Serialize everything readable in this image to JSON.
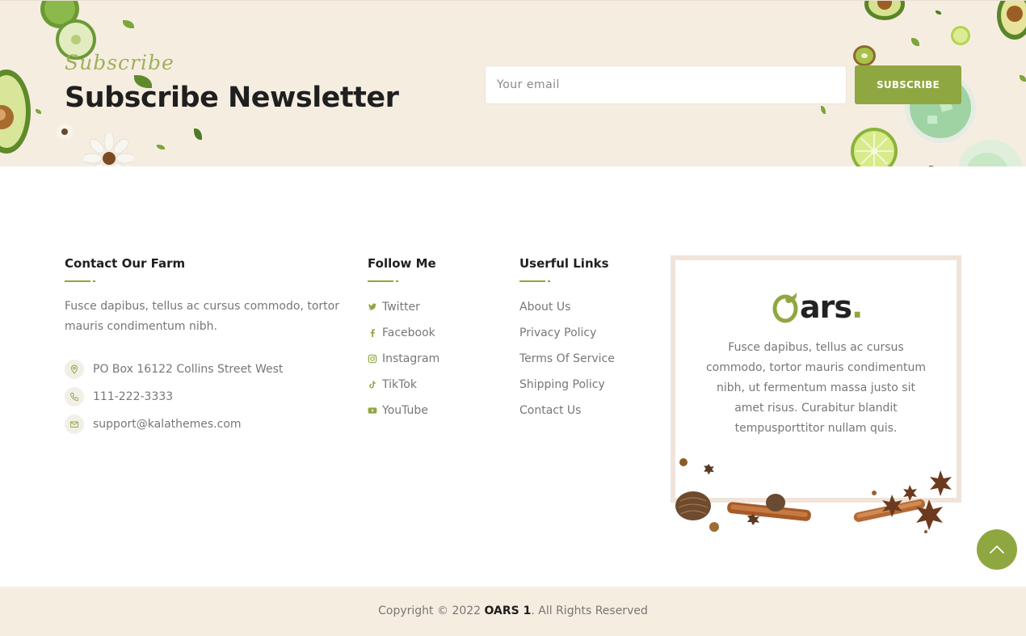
{
  "newsletter": {
    "script_label": "Subscribe",
    "title": "Subscribe Newsletter",
    "email_placeholder": "Your email",
    "button_label": "SUBSCRIBE"
  },
  "contact": {
    "title": "Contact Our Farm",
    "description": "Fusce dapibus, tellus ac cursus commodo, tortor mauris condimentum nibh.",
    "items": [
      {
        "icon": "location-pin-icon",
        "text": "PO Box 16122 Collins Street West"
      },
      {
        "icon": "phone-icon",
        "text": "111-222-3333"
      },
      {
        "icon": "mail-icon",
        "text": "support@kalathemes.com"
      }
    ]
  },
  "follow": {
    "title": "Follow Me",
    "items": [
      {
        "icon": "twitter-icon",
        "label": "Twitter"
      },
      {
        "icon": "facebook-icon",
        "label": "Facebook"
      },
      {
        "icon": "instagram-icon",
        "label": "Instagram"
      },
      {
        "icon": "tiktok-icon",
        "label": "TikTok"
      },
      {
        "icon": "youtube-icon",
        "label": "YouTube"
      }
    ]
  },
  "useful_links": {
    "title": "Userful Links",
    "items": [
      "About Us",
      "Privacy Policy",
      "Terms Of Service",
      "Shipping Policy",
      "Contact Us"
    ]
  },
  "about": {
    "logo_text": "ars",
    "logo_dot": ".",
    "description": "Fusce dapibus, tellus ac cursus commodo, tortor mauris condimentum nibh, ut fermentum massa justo sit amet risus. Curabitur blandit tempusporttitor nullam quis."
  },
  "copyright": {
    "prefix": "Copyright © 2022 ",
    "brand": "OARS 1",
    "suffix": ". All Rights Reserved"
  },
  "colors": {
    "accent": "#8fa740",
    "band_bg": "#f6ede1",
    "heading": "#1f1f1f",
    "body_text": "#777777"
  }
}
